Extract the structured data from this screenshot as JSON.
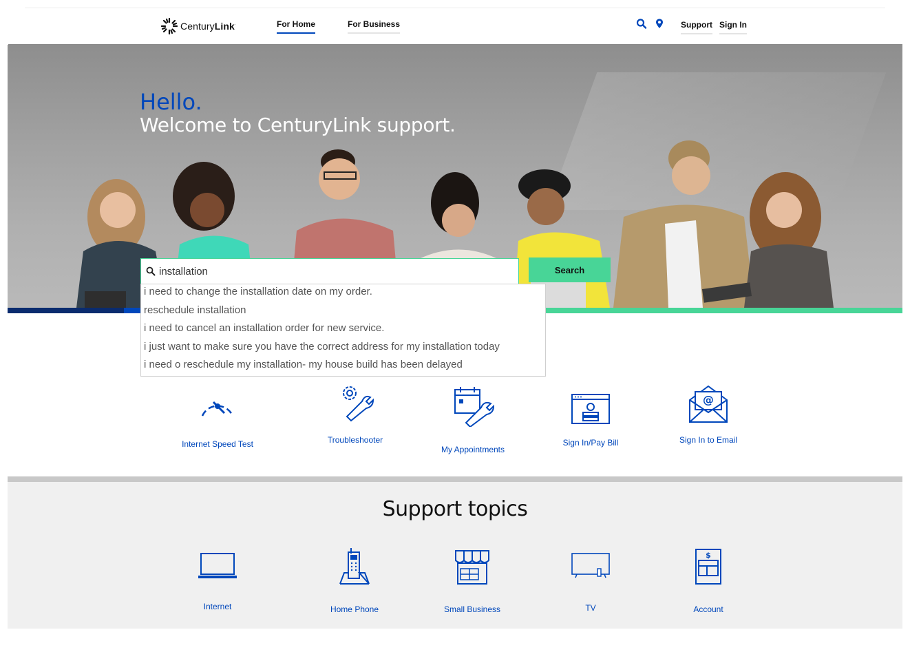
{
  "brand": {
    "name_regular": "Century",
    "name_bold": "Link",
    "trademark": "·"
  },
  "nav": {
    "for_home": "For Home",
    "for_business": "For Business",
    "support": "Support",
    "sign_in": "Sign In"
  },
  "hero": {
    "greeting": "Hello.",
    "welcome": "Welcome to CenturyLink support."
  },
  "search": {
    "value": "installation",
    "button_label": "Search",
    "suggestions": [
      "i need to change the installation date on my order.",
      "reschedule installation",
      "i need to cancel an installation order for new service.",
      "i just want to make sure you have the correct address for my installation today",
      "i need o reschedule my installation- my house build has been delayed"
    ]
  },
  "quick_links": [
    {
      "label": "Internet Speed Test",
      "icon": "speedometer-icon"
    },
    {
      "label": "Troubleshooter",
      "icon": "gear-wrench-icon"
    },
    {
      "label": "My Appointments",
      "icon": "calendar-wrench-icon"
    },
    {
      "label": "Sign In/Pay Bill",
      "icon": "account-screen-icon"
    },
    {
      "label": "Sign In to Email",
      "icon": "email-envelope-icon"
    }
  ],
  "support_topics": {
    "title": "Support topics",
    "items": [
      {
        "label": "Internet",
        "icon": "laptop-icon"
      },
      {
        "label": "Home Phone",
        "icon": "cordless-phone-icon"
      },
      {
        "label": "Small Business",
        "icon": "storefront-icon"
      },
      {
        "label": "TV",
        "icon": "tv-icon"
      },
      {
        "label": "Account",
        "icon": "bill-account-icon"
      }
    ]
  },
  "colors": {
    "brand_blue": "#0047bb",
    "brand_green": "#48d597",
    "navy": "#0a2b6e"
  }
}
